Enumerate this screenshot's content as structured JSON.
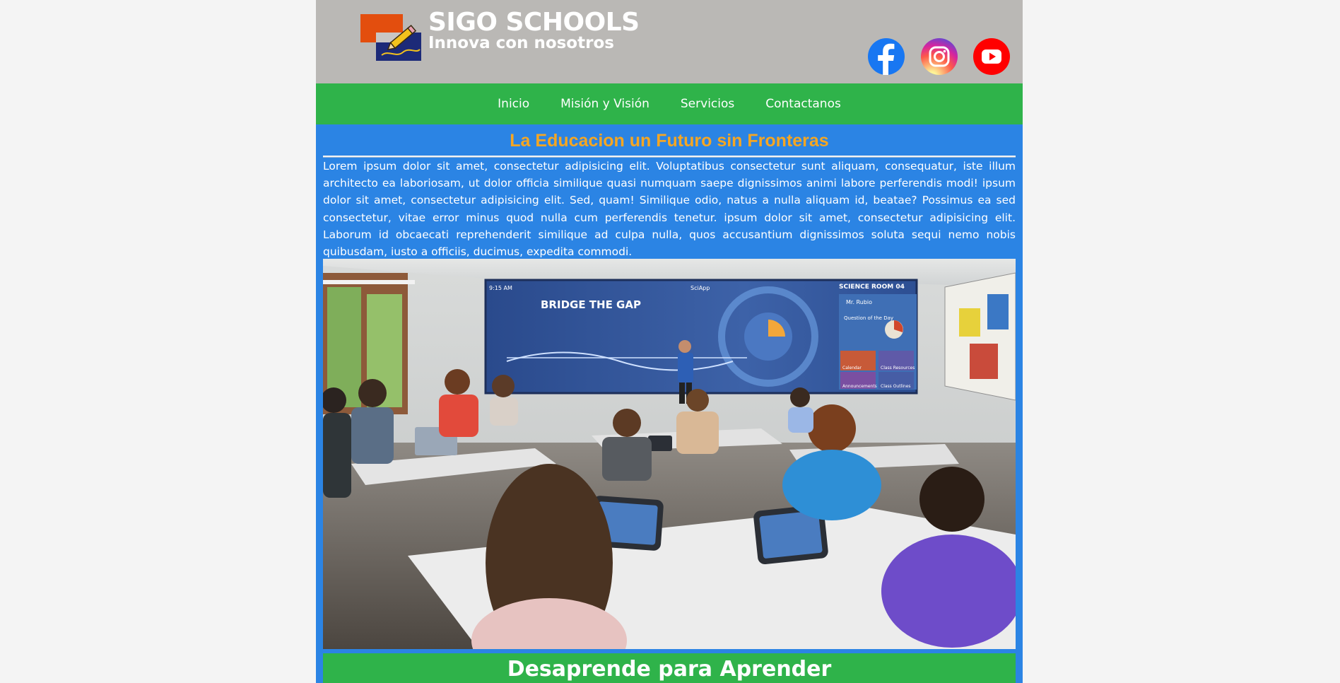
{
  "brand": {
    "title": "SIGO SCHOOLS",
    "slogan": "Innova con nosotros",
    "colors": {
      "orange": "#e34e0e",
      "navy": "#1c2a78",
      "pencil": "#f3c21c"
    }
  },
  "social": [
    {
      "icon": "facebook-icon",
      "color": "#1877f2"
    },
    {
      "icon": "instagram-icon",
      "color": "#d6249f"
    },
    {
      "icon": "youtube-icon",
      "color": "#ff0000"
    }
  ],
  "nav": {
    "items": [
      "Inicio",
      "Misión y Visión",
      "Servicios",
      "Contactanos"
    ]
  },
  "hero": {
    "title": "La Educacion un Futuro sin Fronteras",
    "body": "Lorem ipsum dolor sit amet, consectetur adipisicing elit. Voluptatibus consectetur sunt aliquam, consequatur, iste illum architecto ea laboriosam, ut dolor officia similique quasi numquam saepe dignissimos animi labore perferendis modi! ipsum dolor sit amet, consectetur adipisicing elit. Sed, quam! Similique odio, natus a nulla aliquam id, beatae? Possimus ea sed consectetur, vitae error minus quod nulla cum perferendis tenetur. ipsum dolor sit amet, consectetur adipisicing elit. Laborum id obcaecati reprehenderit similique ad culpa nulla, quos accusantium dignissimos soluta sequi nemo nobis quibusdam, iusto a officiis, ducimus, expedita commodi."
  },
  "image": {
    "screen_header_left": "9:15 AM",
    "screen_app": "SciApp",
    "screen_room": "SCIENCE ROOM 04",
    "screen_headline": "BRIDGE THE GAP",
    "screen_teacher": "Mr. Rubio",
    "screen_question": "Question of the Day",
    "screen_tiles": [
      "Calendar",
      "Class Resources",
      "Announcements",
      "Class Outlines"
    ]
  },
  "section": {
    "title": "Desaprende para Aprender"
  },
  "colors": {
    "page_bg": "#f4f4f4",
    "header_bg": "#bab8b5",
    "nav_bg": "#2fb34a",
    "content_bg": "#2b84e4",
    "title_orange": "#f5a623"
  }
}
